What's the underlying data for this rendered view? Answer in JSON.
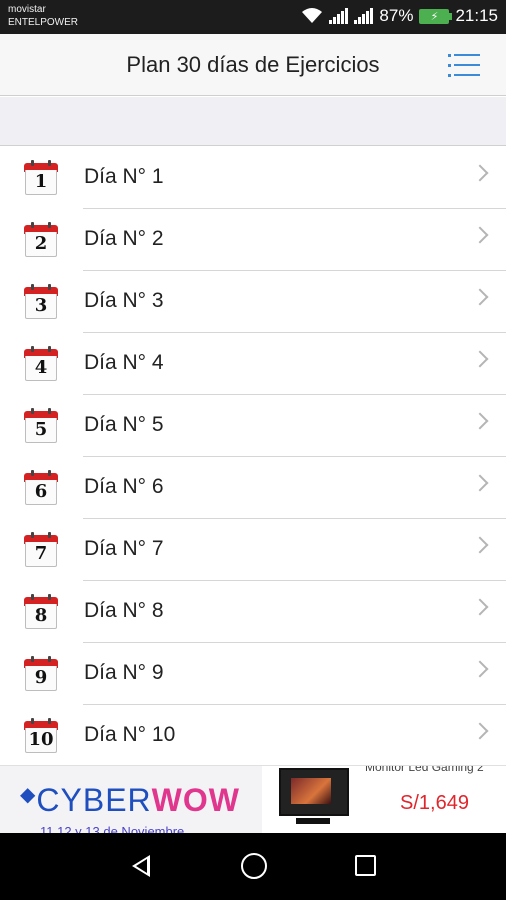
{
  "status_bar": {
    "carrier_line1": "movistar",
    "carrier_line2": "ENTELPOWER",
    "battery_percent": "87%",
    "time": "21:15"
  },
  "header": {
    "title": "Plan 30 días de Ejercicios",
    "menu_icon": "list-menu-icon",
    "accent_color": "#3c8bd8"
  },
  "days": [
    {
      "number": "1",
      "label": "Día N° 1"
    },
    {
      "number": "2",
      "label": "Día N° 2"
    },
    {
      "number": "3",
      "label": "Día N° 3"
    },
    {
      "number": "4",
      "label": "Día N° 4"
    },
    {
      "number": "5",
      "label": "Día N° 5"
    },
    {
      "number": "6",
      "label": "Día N° 6"
    },
    {
      "number": "7",
      "label": "Día N° 7"
    },
    {
      "number": "8",
      "label": "Día N° 8"
    },
    {
      "number": "9",
      "label": "Día N° 9"
    },
    {
      "number": "10",
      "label": "Día N° 10"
    }
  ],
  "ad": {
    "brand_part1": "CYBER",
    "brand_part2": "WOW",
    "dates": "11,12 y 13 de Noviembre",
    "product_name": "Monitor Led Gaming 2",
    "price": "S/1,649"
  }
}
